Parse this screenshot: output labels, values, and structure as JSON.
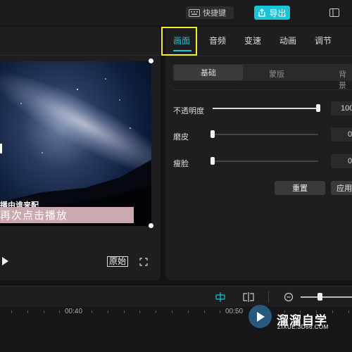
{
  "topbar": {
    "shortcut_label": "快捷键",
    "export_label": "导出"
  },
  "preview": {
    "caption_small": "播由谁来配",
    "caption_big": "再次点击播放",
    "original_label": "原始"
  },
  "panel": {
    "tabs": [
      "画面",
      "音频",
      "变速",
      "动画",
      "调节"
    ],
    "active_tab": "画面",
    "subtabs": [
      "基础",
      "蒙版",
      "背景"
    ],
    "rows": [
      {
        "label": "不透明度",
        "value": "100",
        "fraction": 1.0
      },
      {
        "label": "磨皮",
        "value": "0",
        "fraction": 0.0
      },
      {
        "label": "瘦脸",
        "value": "0",
        "fraction": 0.0
      }
    ],
    "reset_label": "重置",
    "apply_label": "应用"
  },
  "timeline": {
    "time_labels": [
      "00:40",
      "00:50"
    ],
    "zoom_fraction": 0.37
  },
  "watermark": {
    "title": "溜溜自学",
    "url": "ZIXUE.3D66.COM"
  },
  "colors": {
    "accent": "#19c4d6",
    "highlight_box": "#f3ef1e",
    "caption_bg": "#c9a9ae"
  },
  "icons": [
    "keyboard-icon",
    "export-icon",
    "layout-icon",
    "play-icon",
    "fullscreen-icon",
    "snap-icon",
    "split-icon",
    "zoom-out-icon",
    "watermark-play-icon"
  ]
}
